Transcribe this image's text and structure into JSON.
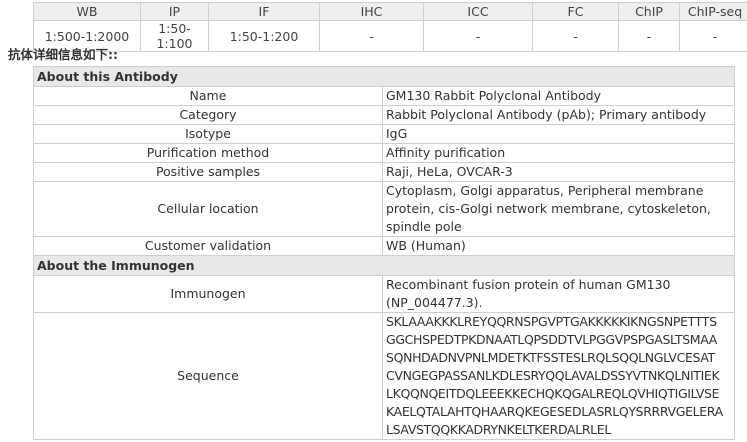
{
  "applications": {
    "headers": [
      "WB",
      "IP",
      "IF",
      "IHC",
      "ICC",
      "FC",
      "ChIP",
      "ChIP-seq"
    ],
    "values": [
      "1:500-1:2000",
      "1:50-1:100",
      "1:50-1:200",
      "-",
      "-",
      "-",
      "-",
      "-"
    ]
  },
  "details_heading": "抗体详细信息如下::",
  "antibody_section": {
    "title": "About this Antibody",
    "rows": [
      {
        "label": "Name",
        "value": "GM130 Rabbit Polyclonal Antibody"
      },
      {
        "label": "Category",
        "value": "Rabbit Polyclonal Antibody (pAb); Primary antibody"
      },
      {
        "label": "Isotype",
        "value": "IgG"
      },
      {
        "label": "Purification method",
        "value": "Affinity purification"
      },
      {
        "label": "Positive samples",
        "value": "Raji, HeLa, OVCAR-3"
      },
      {
        "label": "Cellular location",
        "value": "Cytoplasm, Golgi apparatus, Peripheral membrane protein, cis-Golgi network membrane, cytoskeleton, spindle pole"
      },
      {
        "label": "Customer validation",
        "value": "WB (Human)"
      }
    ]
  },
  "immunogen_section": {
    "title": "About the Immunogen",
    "immunogen_label": "Immunogen",
    "immunogen_value": "Recombinant fusion protein of human GM130 (NP_004477.3).",
    "sequence_label": "Sequence",
    "sequence_lines": [
      "SKLAAAKKKLREYQQRNSPGVPTGAKKKKKIKNGSNPETTTS",
      "GGCHSPEDTPKDNAATLQPSDDTVLPGGVPSPGASLTSMAA",
      "SQNHDADNVPNLMDETKTFSSTESLRQLSQQLNGLVCESAT",
      "CVNGEGPASSANLKDLESRYQQLAVALDSSYVTNKQLNITIEK",
      "LKQQNQEITDQLEEEKKECHQKQGALREQLQVHIQTIGILVSE",
      "KAELQTALAHTQHAARQKEGESEDLASRLQYSRRRVGELERA",
      "LSAVSTQQKKADRYNKELTKERDALRLEL"
    ]
  }
}
